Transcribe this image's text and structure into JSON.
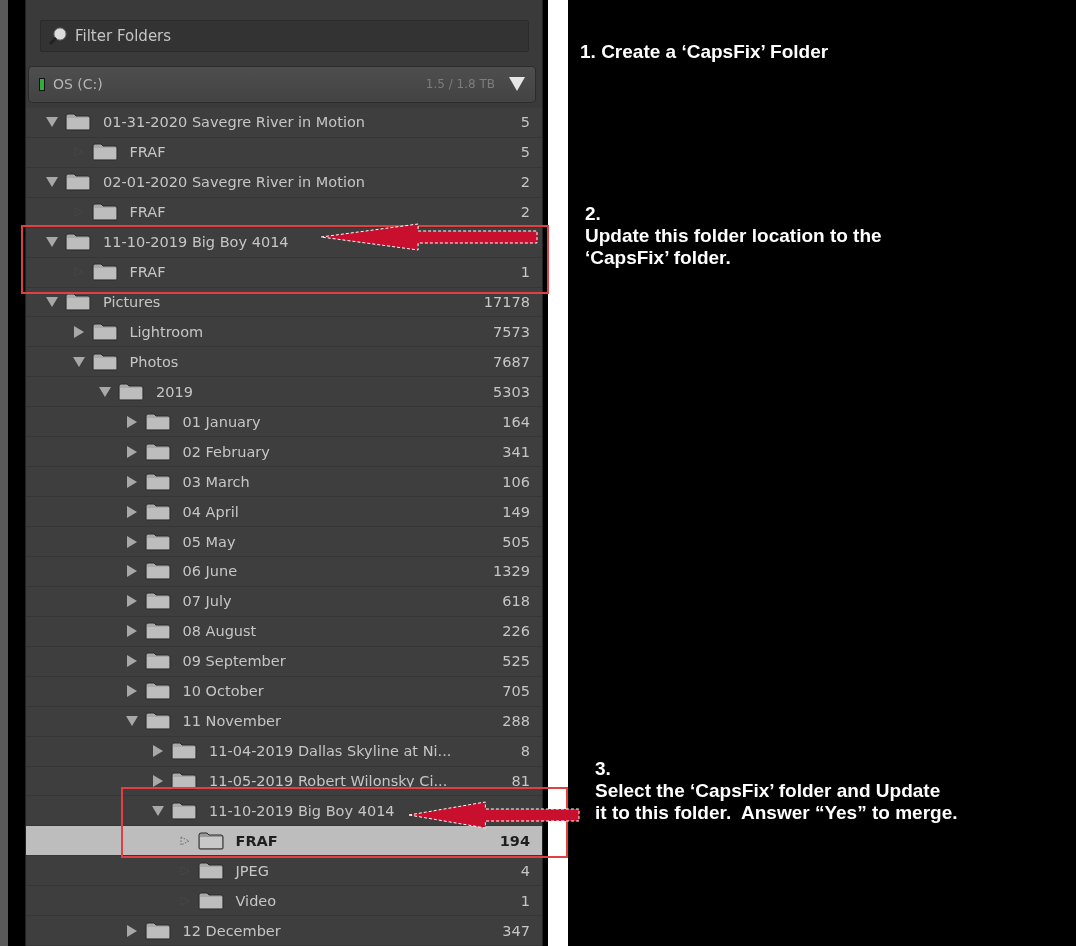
{
  "filter": {
    "placeholder": "Filter Folders"
  },
  "volume": {
    "name": "OS (C:)",
    "usage": "1.5 / 1.8 TB",
    "color": "#2fae3a"
  },
  "folders": [
    {
      "name": "01-31-2020 Savegre River in Motion",
      "count": "5",
      "expanded": true,
      "selected": false,
      "children": [
        {
          "name": "FRAF",
          "count": "5",
          "selected": false
        }
      ]
    },
    {
      "name": "02-01-2020 Savegre River in Motion",
      "count": "2",
      "expanded": true,
      "selected": false,
      "children": [
        {
          "name": "FRAF",
          "count": "2",
          "selected": false
        }
      ]
    },
    {
      "name": "11-10-2019 Big Boy 4014",
      "expanded": true,
      "selected": false,
      "children": [
        {
          "name": "FRAF",
          "count": "1",
          "selected": false
        }
      ]
    },
    {
      "name": "Pictures",
      "count": "17178",
      "expanded": true,
      "selected": false,
      "children": [
        {
          "name": "Lightroom",
          "count": "7573",
          "expanded": false,
          "selected": false
        },
        {
          "name": "Photos",
          "count": "7687",
          "expanded": true,
          "selected": false,
          "children": [
            {
              "name": "2019",
              "count": "5303",
              "expanded": true,
              "selected": false,
              "children": [
                {
                  "name": "01 January",
                  "count": "164",
                  "expanded": false,
                  "selected": false
                },
                {
                  "name": "02 February",
                  "count": "341",
                  "expanded": false,
                  "selected": false
                },
                {
                  "name": "03 March",
                  "count": "106",
                  "expanded": false,
                  "selected": false
                },
                {
                  "name": "04 April",
                  "count": "149",
                  "expanded": false,
                  "selected": false
                },
                {
                  "name": "05 May",
                  "count": "505",
                  "expanded": false,
                  "selected": false
                },
                {
                  "name": "06 June",
                  "count": "1329",
                  "expanded": false,
                  "selected": false
                },
                {
                  "name": "07 July",
                  "count": "618",
                  "expanded": false,
                  "selected": false
                },
                {
                  "name": "08 August",
                  "count": "226",
                  "expanded": false,
                  "selected": false
                },
                {
                  "name": "09 September",
                  "count": "525",
                  "expanded": false,
                  "selected": false
                },
                {
                  "name": "10 October",
                  "count": "705",
                  "expanded": false,
                  "selected": false
                },
                {
                  "name": "11 November",
                  "count": "288",
                  "expanded": true,
                  "selected": false,
                  "children": [
                    {
                      "name": "11-04-2019 Dallas Skyline at Ni...",
                      "count": "8",
                      "expanded": false,
                      "selected": false
                    },
                    {
                      "name": "11-05-2019 Robert Wilonsky Ci...",
                      "count": "81",
                      "expanded": false,
                      "selected": false
                    },
                    {
                      "name": "11-10-2019 Big Boy 4014",
                      "expanded": true,
                      "selected": false,
                      "children": [
                        {
                          "name": "FRAF",
                          "count": "194",
                          "selected": true
                        },
                        {
                          "name": "JPEG",
                          "count": "4",
                          "selected": false
                        },
                        {
                          "name": "Video",
                          "count": "1",
                          "selected": false
                        }
                      ]
                    }
                  ]
                },
                {
                  "name": "12 December",
                  "count": "347",
                  "expanded": false,
                  "selected": false
                }
              ]
            }
          ]
        }
      ]
    }
  ],
  "notes": [
    {
      "kind": "inline",
      "number": "1.",
      "text": "Create a ‘CapsFix’ Folder"
    },
    {
      "kind": "stacked",
      "number": "2.",
      "text": "Update this folder location to the\n‘CapsFix’ folder."
    },
    {
      "kind": "stacked",
      "number": "3.",
      "text": "Select the ‘CapsFix’ folder and Update\nit to this folder.  Answer “Yes” to merge."
    }
  ]
}
